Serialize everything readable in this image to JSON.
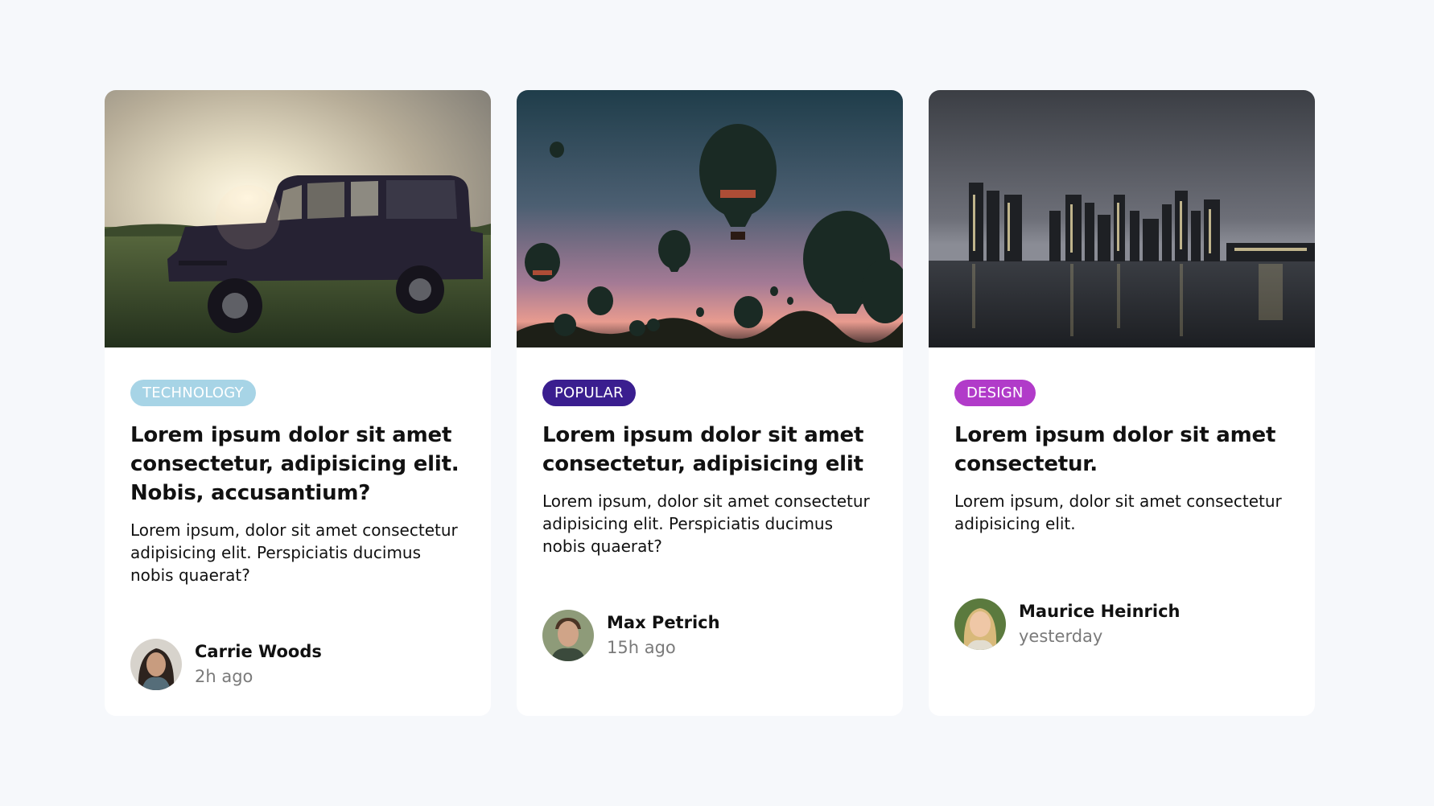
{
  "colors": {
    "background": "#f6f8fb",
    "tag_technology": "#a7d4e6",
    "tag_popular": "#3a1e8f",
    "tag_design": "#b13bc9"
  },
  "cards": [
    {
      "image": "vintage-jeep-sunset-photo",
      "tag": "TECHNOLOGY",
      "title": "Lorem ipsum dolor sit amet consectetur, adipisicing elit. Nobis, accusantium?",
      "description": "Lorem ipsum, dolor sit amet consectetur adipisicing elit. Perspiciatis ducimus nobis quaerat?",
      "author": {
        "name": "Carrie Woods",
        "time": "2h ago"
      }
    },
    {
      "image": "hot-air-balloons-photo",
      "tag": "POPULAR",
      "title": "Lorem ipsum dolor sit amet consectetur, adipisicing elit",
      "description": "Lorem ipsum, dolor sit amet consectetur adipisicing elit. Perspiciatis ducimus nobis quaerat?",
      "author": {
        "name": "Max Petrich",
        "time": "15h ago"
      }
    },
    {
      "image": "city-skyline-night-photo",
      "tag": "DESIGN",
      "title": "Lorem ipsum dolor sit amet consectetur.",
      "description": "Lorem ipsum, dolor sit amet consectetur adipisicing elit.",
      "author": {
        "name": "Maurice Heinrich",
        "time": "yesterday"
      }
    }
  ]
}
